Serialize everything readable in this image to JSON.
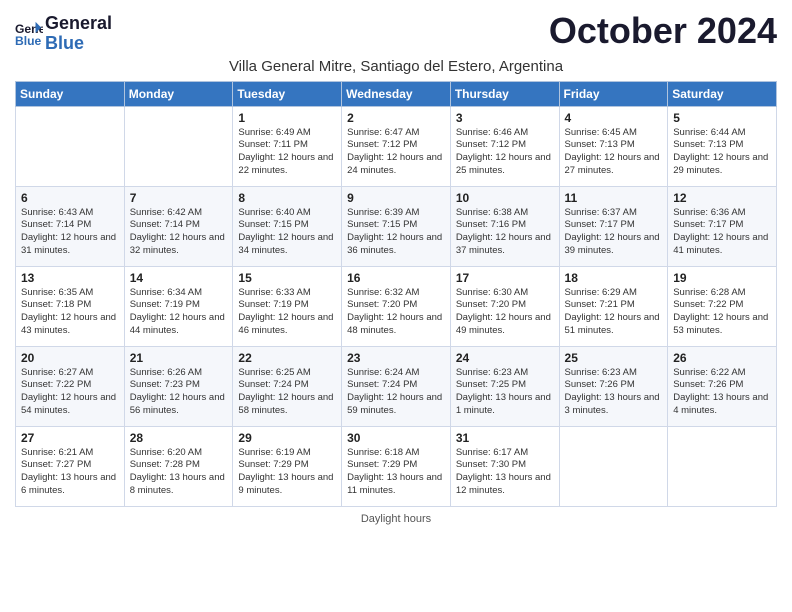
{
  "header": {
    "logo_line1": "General",
    "logo_line2": "Blue",
    "month_title": "October 2024",
    "subtitle": "Villa General Mitre, Santiago del Estero, Argentina"
  },
  "days_of_week": [
    "Sunday",
    "Monday",
    "Tuesday",
    "Wednesday",
    "Thursday",
    "Friday",
    "Saturday"
  ],
  "weeks": [
    [
      {
        "day": "",
        "sunrise": "",
        "sunset": "",
        "daylight": ""
      },
      {
        "day": "",
        "sunrise": "",
        "sunset": "",
        "daylight": ""
      },
      {
        "day": "1",
        "sunrise": "Sunrise: 6:49 AM",
        "sunset": "Sunset: 7:11 PM",
        "daylight": "Daylight: 12 hours and 22 minutes."
      },
      {
        "day": "2",
        "sunrise": "Sunrise: 6:47 AM",
        "sunset": "Sunset: 7:12 PM",
        "daylight": "Daylight: 12 hours and 24 minutes."
      },
      {
        "day": "3",
        "sunrise": "Sunrise: 6:46 AM",
        "sunset": "Sunset: 7:12 PM",
        "daylight": "Daylight: 12 hours and 25 minutes."
      },
      {
        "day": "4",
        "sunrise": "Sunrise: 6:45 AM",
        "sunset": "Sunset: 7:13 PM",
        "daylight": "Daylight: 12 hours and 27 minutes."
      },
      {
        "day": "5",
        "sunrise": "Sunrise: 6:44 AM",
        "sunset": "Sunset: 7:13 PM",
        "daylight": "Daylight: 12 hours and 29 minutes."
      }
    ],
    [
      {
        "day": "6",
        "sunrise": "Sunrise: 6:43 AM",
        "sunset": "Sunset: 7:14 PM",
        "daylight": "Daylight: 12 hours and 31 minutes."
      },
      {
        "day": "7",
        "sunrise": "Sunrise: 6:42 AM",
        "sunset": "Sunset: 7:14 PM",
        "daylight": "Daylight: 12 hours and 32 minutes."
      },
      {
        "day": "8",
        "sunrise": "Sunrise: 6:40 AM",
        "sunset": "Sunset: 7:15 PM",
        "daylight": "Daylight: 12 hours and 34 minutes."
      },
      {
        "day": "9",
        "sunrise": "Sunrise: 6:39 AM",
        "sunset": "Sunset: 7:15 PM",
        "daylight": "Daylight: 12 hours and 36 minutes."
      },
      {
        "day": "10",
        "sunrise": "Sunrise: 6:38 AM",
        "sunset": "Sunset: 7:16 PM",
        "daylight": "Daylight: 12 hours and 37 minutes."
      },
      {
        "day": "11",
        "sunrise": "Sunrise: 6:37 AM",
        "sunset": "Sunset: 7:17 PM",
        "daylight": "Daylight: 12 hours and 39 minutes."
      },
      {
        "day": "12",
        "sunrise": "Sunrise: 6:36 AM",
        "sunset": "Sunset: 7:17 PM",
        "daylight": "Daylight: 12 hours and 41 minutes."
      }
    ],
    [
      {
        "day": "13",
        "sunrise": "Sunrise: 6:35 AM",
        "sunset": "Sunset: 7:18 PM",
        "daylight": "Daylight: 12 hours and 43 minutes."
      },
      {
        "day": "14",
        "sunrise": "Sunrise: 6:34 AM",
        "sunset": "Sunset: 7:19 PM",
        "daylight": "Daylight: 12 hours and 44 minutes."
      },
      {
        "day": "15",
        "sunrise": "Sunrise: 6:33 AM",
        "sunset": "Sunset: 7:19 PM",
        "daylight": "Daylight: 12 hours and 46 minutes."
      },
      {
        "day": "16",
        "sunrise": "Sunrise: 6:32 AM",
        "sunset": "Sunset: 7:20 PM",
        "daylight": "Daylight: 12 hours and 48 minutes."
      },
      {
        "day": "17",
        "sunrise": "Sunrise: 6:30 AM",
        "sunset": "Sunset: 7:20 PM",
        "daylight": "Daylight: 12 hours and 49 minutes."
      },
      {
        "day": "18",
        "sunrise": "Sunrise: 6:29 AM",
        "sunset": "Sunset: 7:21 PM",
        "daylight": "Daylight: 12 hours and 51 minutes."
      },
      {
        "day": "19",
        "sunrise": "Sunrise: 6:28 AM",
        "sunset": "Sunset: 7:22 PM",
        "daylight": "Daylight: 12 hours and 53 minutes."
      }
    ],
    [
      {
        "day": "20",
        "sunrise": "Sunrise: 6:27 AM",
        "sunset": "Sunset: 7:22 PM",
        "daylight": "Daylight: 12 hours and 54 minutes."
      },
      {
        "day": "21",
        "sunrise": "Sunrise: 6:26 AM",
        "sunset": "Sunset: 7:23 PM",
        "daylight": "Daylight: 12 hours and 56 minutes."
      },
      {
        "day": "22",
        "sunrise": "Sunrise: 6:25 AM",
        "sunset": "Sunset: 7:24 PM",
        "daylight": "Daylight: 12 hours and 58 minutes."
      },
      {
        "day": "23",
        "sunrise": "Sunrise: 6:24 AM",
        "sunset": "Sunset: 7:24 PM",
        "daylight": "Daylight: 12 hours and 59 minutes."
      },
      {
        "day": "24",
        "sunrise": "Sunrise: 6:23 AM",
        "sunset": "Sunset: 7:25 PM",
        "daylight": "Daylight: 13 hours and 1 minute."
      },
      {
        "day": "25",
        "sunrise": "Sunrise: 6:23 AM",
        "sunset": "Sunset: 7:26 PM",
        "daylight": "Daylight: 13 hours and 3 minutes."
      },
      {
        "day": "26",
        "sunrise": "Sunrise: 6:22 AM",
        "sunset": "Sunset: 7:26 PM",
        "daylight": "Daylight: 13 hours and 4 minutes."
      }
    ],
    [
      {
        "day": "27",
        "sunrise": "Sunrise: 6:21 AM",
        "sunset": "Sunset: 7:27 PM",
        "daylight": "Daylight: 13 hours and 6 minutes."
      },
      {
        "day": "28",
        "sunrise": "Sunrise: 6:20 AM",
        "sunset": "Sunset: 7:28 PM",
        "daylight": "Daylight: 13 hours and 8 minutes."
      },
      {
        "day": "29",
        "sunrise": "Sunrise: 6:19 AM",
        "sunset": "Sunset: 7:29 PM",
        "daylight": "Daylight: 13 hours and 9 minutes."
      },
      {
        "day": "30",
        "sunrise": "Sunrise: 6:18 AM",
        "sunset": "Sunset: 7:29 PM",
        "daylight": "Daylight: 13 hours and 11 minutes."
      },
      {
        "day": "31",
        "sunrise": "Sunrise: 6:17 AM",
        "sunset": "Sunset: 7:30 PM",
        "daylight": "Daylight: 13 hours and 12 minutes."
      },
      {
        "day": "",
        "sunrise": "",
        "sunset": "",
        "daylight": ""
      },
      {
        "day": "",
        "sunrise": "",
        "sunset": "",
        "daylight": ""
      }
    ]
  ],
  "footer": {
    "note": "Daylight hours"
  }
}
